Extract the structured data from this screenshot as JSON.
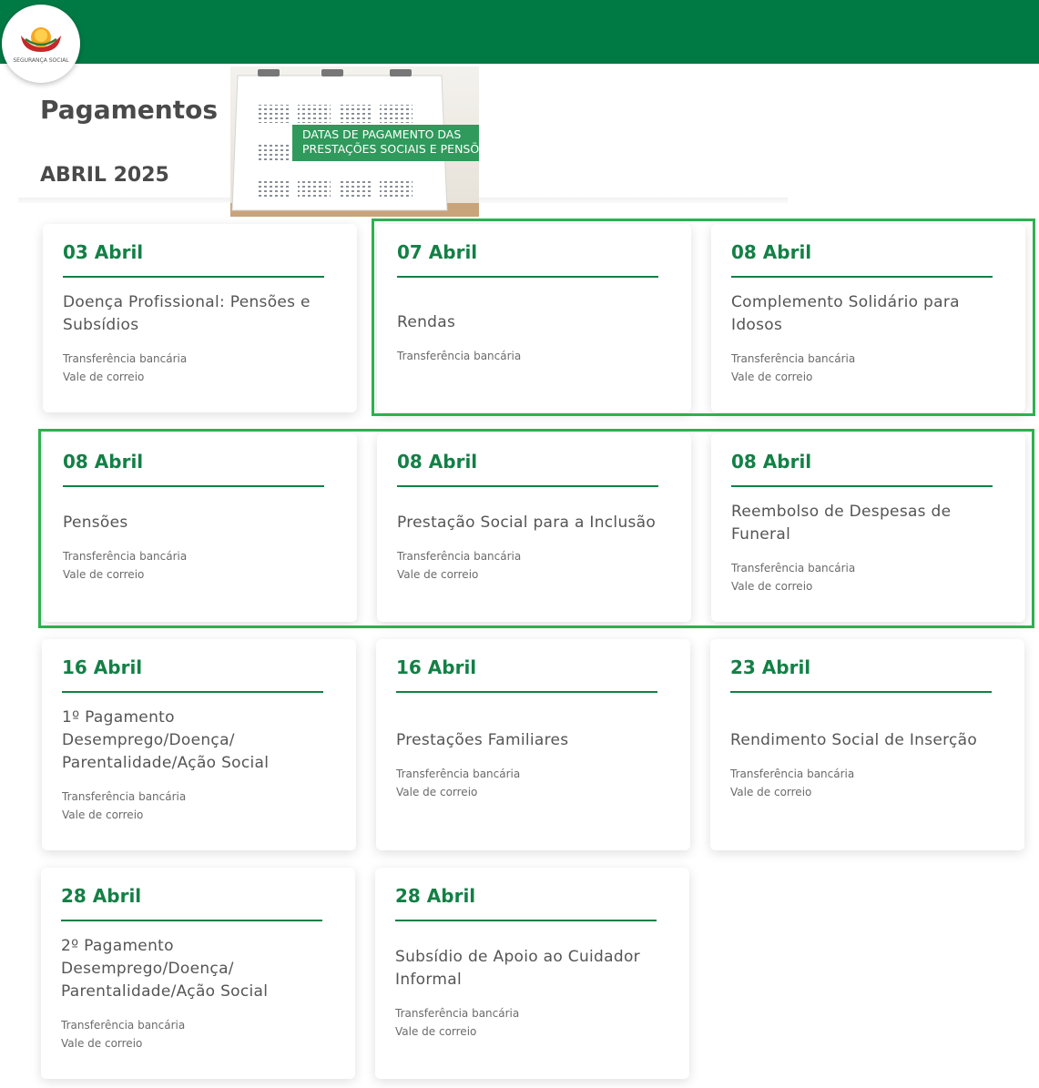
{
  "header": {
    "logo_text": "SEGURANÇA SOCIAL",
    "bar_color": "#007a45"
  },
  "page": {
    "title": "Pagamentos",
    "month": "ABRIL 2025"
  },
  "banner": {
    "line1": "DATAS DE PAGAMENTO DAS",
    "line2": "PRESTAÇÕES SOCIAIS E PENSÕES"
  },
  "colors": {
    "accent": "#138046",
    "highlight": "#2eb04f"
  },
  "cards": [
    {
      "date": "03 Abril",
      "name": "Doença Profissional: Pensões e Subsídios",
      "methods": [
        "Transferência bancária",
        "Vale de correio"
      ]
    },
    {
      "date": "07 Abril",
      "name": "Rendas",
      "methods": [
        "Transferência bancária"
      ]
    },
    {
      "date": "08 Abril",
      "name": "Complemento Solidário para Idosos",
      "methods": [
        "Transferência bancária",
        "Vale de correio"
      ]
    },
    {
      "date": "08 Abril",
      "name": "Pensões",
      "methods": [
        "Transferência bancária",
        "Vale de correio"
      ]
    },
    {
      "date": "08 Abril",
      "name": "Prestação Social para a Inclusão",
      "methods": [
        "Transferência bancária",
        "Vale de correio"
      ]
    },
    {
      "date": "08 Abril",
      "name": "Reembolso de Despesas de Funeral",
      "methods": [
        "Transferência bancária",
        "Vale de correio"
      ]
    },
    {
      "date": "16 Abril",
      "name": "1º Pagamento Desemprego/Doença/ Parentalidade/Ação Social",
      "methods": [
        "Transferência bancária",
        "Vale de correio"
      ]
    },
    {
      "date": "16 Abril",
      "name": "Prestações Familiares",
      "methods": [
        "Transferência bancária",
        "Vale de correio"
      ]
    },
    {
      "date": "23 Abril",
      "name": "Rendimento Social de Inserção",
      "methods": [
        "Transferência bancária",
        "Vale de correio"
      ]
    },
    {
      "date": "28 Abril",
      "name": "2º Pagamento Desemprego/Doença/ Parentalidade/Ação Social",
      "methods": [
        "Transferência bancária",
        "Vale de correio"
      ]
    },
    {
      "date": "28 Abril",
      "name": "Subsídio de Apoio ao Cuidador Informal",
      "methods": [
        "Transferência bancária",
        "Vale de correio"
      ]
    }
  ]
}
